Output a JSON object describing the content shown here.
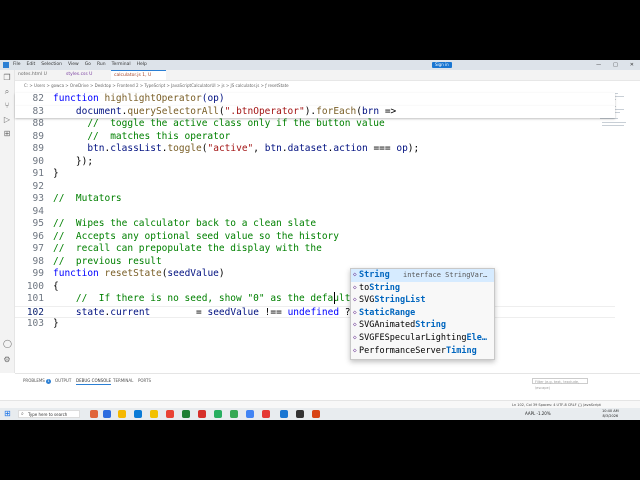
{
  "menus": [
    "File",
    "Edit",
    "Selection",
    "View",
    "Go",
    "Run",
    "Terminal",
    "Help"
  ],
  "signin": "Sign in",
  "window_controls": [
    "—",
    "□",
    "✕"
  ],
  "tabs": [
    {
      "label": "notes.html U"
    },
    {
      "label": "styles.css U"
    },
    {
      "label": "calculator.js 1, U"
    }
  ],
  "breadcrumb": "C: > Users > gowca > OneDrive > Desktop > Frontend 2 > TypeScript > JavaScriptCalculatorUI > js > JS calculator.js > ƒ resetState",
  "lines": [
    {
      "num": "82",
      "tokens": [
        {
          "t": "function ",
          "c": "kw"
        },
        {
          "t": "highlightOperator",
          "c": "fn"
        },
        {
          "t": "(op)",
          "c": "var"
        }
      ]
    },
    {
      "num": "83",
      "tokens": [
        {
          "t": "    document",
          "c": "var"
        },
        {
          "t": ".",
          "c": ""
        },
        {
          "t": "querySelectorAll",
          "c": "fn"
        },
        {
          "t": "(",
          "c": ""
        },
        {
          "t": "\".btnOperator\"",
          "c": "str"
        },
        {
          "t": ").",
          "c": ""
        },
        {
          "t": "forEach",
          "c": "fn"
        },
        {
          "t": "(",
          "c": ""
        },
        {
          "t": "brn",
          "c": "var"
        },
        {
          "t": " =>",
          "c": ""
        }
      ]
    },
    {
      "num": "88",
      "tokens": [
        {
          "t": "      //  toggle the active class only if the button value",
          "c": "cm"
        }
      ]
    },
    {
      "num": "89",
      "tokens": [
        {
          "t": "      //  matches this operator",
          "c": "cm"
        }
      ]
    },
    {
      "num": "89",
      "tokens": [
        {
          "t": "      btn",
          "c": "var"
        },
        {
          "t": ".",
          "c": ""
        },
        {
          "t": "classList",
          "c": "var"
        },
        {
          "t": ".",
          "c": ""
        },
        {
          "t": "toggle",
          "c": "fn"
        },
        {
          "t": "(",
          "c": ""
        },
        {
          "t": "\"active\"",
          "c": "str"
        },
        {
          "t": ", ",
          "c": ""
        },
        {
          "t": "btn",
          "c": "var"
        },
        {
          "t": ".",
          "c": ""
        },
        {
          "t": "dataset",
          "c": "var"
        },
        {
          "t": ".",
          "c": ""
        },
        {
          "t": "action",
          "c": "var"
        },
        {
          "t": " === ",
          "c": ""
        },
        {
          "t": "op",
          "c": "var"
        },
        {
          "t": ");",
          "c": ""
        }
      ]
    },
    {
      "num": "90",
      "tokens": [
        {
          "t": "    });",
          "c": ""
        }
      ]
    },
    {
      "num": "91",
      "tokens": [
        {
          "t": "}",
          "c": ""
        }
      ]
    },
    {
      "num": "92",
      "tokens": []
    },
    {
      "num": "93",
      "tokens": [
        {
          "t": "//  Mutators",
          "c": "cm"
        }
      ]
    },
    {
      "num": "94",
      "tokens": []
    },
    {
      "num": "95",
      "tokens": [
        {
          "t": "//  Wipes the calculator back to a clean slate",
          "c": "cm"
        }
      ]
    },
    {
      "num": "96",
      "tokens": [
        {
          "t": "//  Accepts any optional seed value so the history",
          "c": "cm"
        }
      ]
    },
    {
      "num": "97",
      "tokens": [
        {
          "t": "//  recall can prepopulate the display with the",
          "c": "cm"
        }
      ]
    },
    {
      "num": "98",
      "tokens": [
        {
          "t": "//  previous result",
          "c": "cm"
        }
      ]
    },
    {
      "num": "99",
      "tokens": [
        {
          "t": "function ",
          "c": "kw"
        },
        {
          "t": "resetState",
          "c": "fn"
        },
        {
          "t": "(",
          "c": ""
        },
        {
          "t": "seedValue",
          "c": "var"
        },
        {
          "t": ")",
          "c": ""
        }
      ]
    },
    {
      "num": "100",
      "tokens": [
        {
          "t": "{",
          "c": ""
        }
      ]
    },
    {
      "num": "101",
      "tokens": [
        {
          "t": "    //  If there is no seed, show \"0\" as the default displ",
          "c": "cm"
        }
      ]
    },
    {
      "num": "102",
      "tokens": [
        {
          "t": "    state",
          "c": "var"
        },
        {
          "t": ".",
          "c": ""
        },
        {
          "t": "current",
          "c": "var"
        },
        {
          "t": "        = ",
          "c": ""
        },
        {
          "t": "seedValue",
          "c": "var"
        },
        {
          "t": " !== ",
          "c": ""
        },
        {
          "t": "undefined",
          "c": "kw"
        },
        {
          "t": " ? ",
          "c": ""
        },
        {
          "t": "String",
          "c": "var"
        }
      ]
    },
    {
      "num": "103",
      "tokens": [
        {
          "t": "}",
          "c": ""
        }
      ]
    }
  ],
  "suggestions": [
    {
      "icon": "◇",
      "match": "String",
      "rest": "",
      "detail": "interface StringVar…",
      "selected": true
    },
    {
      "icon": "◇",
      "match": "",
      "pre": "to",
      "rest": "String",
      "detail": ""
    },
    {
      "icon": "◇",
      "match": "",
      "pre": "SVG",
      "rest": "StringList",
      "detail": ""
    },
    {
      "icon": "◇",
      "match": "",
      "pre": "",
      "rest": "StaticRange",
      "detail": ""
    },
    {
      "icon": "◇",
      "match": "",
      "pre": "SVGAnimated",
      "rest": "String",
      "detail": ""
    },
    {
      "icon": "◇",
      "match": "",
      "pre": "SVGFESpecularLighting",
      "rest": "Ele…",
      "detail": ""
    },
    {
      "icon": "◇",
      "match": "",
      "pre": "PerformanceServer",
      "rest": "Timing",
      "detail": ""
    }
  ],
  "panel_tabs": [
    "PROBLEMS",
    "OUTPUT",
    "DEBUG CONSOLE",
    "TERMINAL",
    "PORTS"
  ],
  "problems_count": "1",
  "panel_filter_placeholder": "Filter (e.g. text, !exclude, \\escape)",
  "statusbar": "Ln 102, Col 39   Spaces: 4   UTF-8   CRLF   {} JavaScript",
  "taskbar_search": "Type here to search",
  "tray": "AAPL  -1.20%",
  "clock_time": "10:40 AM",
  "clock_date": "8/3/2026"
}
